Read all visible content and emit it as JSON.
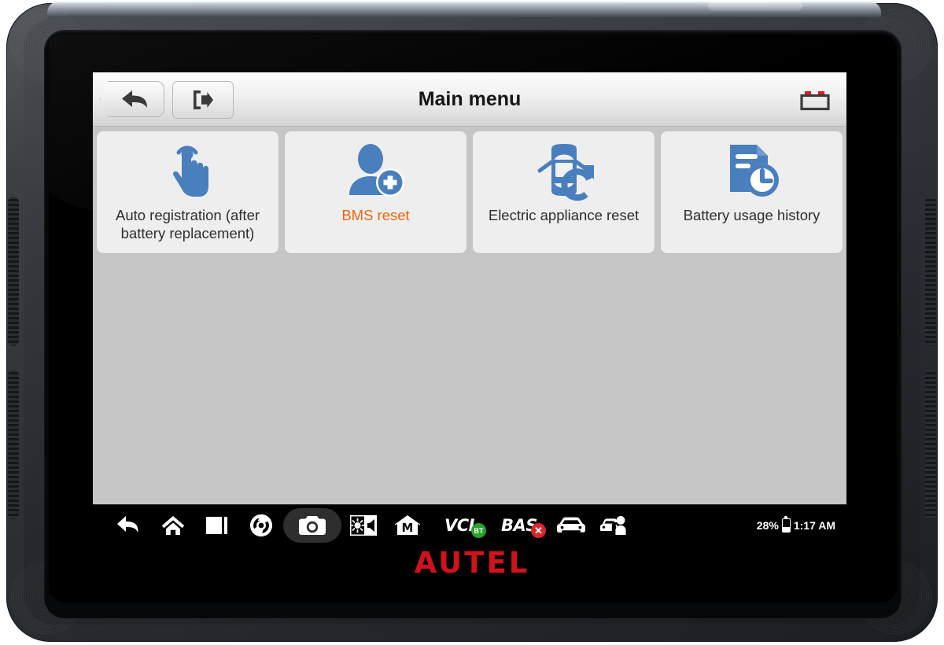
{
  "device": {
    "brand_logo": "AUTEL",
    "brand_color": "#d0121b"
  },
  "header": {
    "title": "Main menu",
    "back_button": {
      "name": "back",
      "icon": "back-arrow-icon"
    },
    "exit_button": {
      "name": "exit",
      "icon": "exit-icon"
    },
    "battery_icon": "battery-terminal-icon"
  },
  "theme": {
    "accent_orange": "#ec6608",
    "icon_blue": "#4a7fbd",
    "screen_bg": "#c6c6c6",
    "tile_bg": "#eeeeee"
  },
  "main": {
    "tiles": [
      {
        "label": "Auto registration (after battery replacement)",
        "icon": "touch-hand-icon",
        "selected": false
      },
      {
        "label": "BMS reset",
        "icon": "user-add-icon",
        "selected": true
      },
      {
        "label": "Electric appliance reset",
        "icon": "car-reset-icon",
        "selected": false
      },
      {
        "label": "Battery usage history",
        "icon": "document-clock-icon",
        "selected": false
      }
    ]
  },
  "navbar": {
    "items": [
      {
        "icon": "back-arrow-icon",
        "label": "",
        "selected": false,
        "badge": ""
      },
      {
        "icon": "home-icon",
        "label": "",
        "selected": false,
        "badge": ""
      },
      {
        "icon": "recent-apps-icon",
        "label": "",
        "selected": false,
        "badge": ""
      },
      {
        "icon": "chrome-browser-icon",
        "label": "",
        "selected": false,
        "badge": ""
      },
      {
        "icon": "camera-icon",
        "label": "",
        "selected": true,
        "badge": ""
      },
      {
        "icon": "brightness-volume-icon",
        "label": "",
        "selected": false,
        "badge": ""
      },
      {
        "icon": "maxi-home-icon",
        "label": "",
        "selected": false,
        "badge": ""
      },
      {
        "icon": "vci-icon",
        "label": "VCI",
        "selected": false,
        "badge": "BT"
      },
      {
        "icon": "bas-icon",
        "label": "BAS",
        "selected": false,
        "badge": "✕"
      },
      {
        "icon": "car-icon",
        "label": "",
        "selected": false,
        "badge": ""
      },
      {
        "icon": "car-service-icon",
        "label": "",
        "selected": false,
        "badge": ""
      }
    ],
    "status": {
      "battery_percent": "28%",
      "battery_icon": "battery-icon",
      "clock": "1:17 AM"
    }
  }
}
